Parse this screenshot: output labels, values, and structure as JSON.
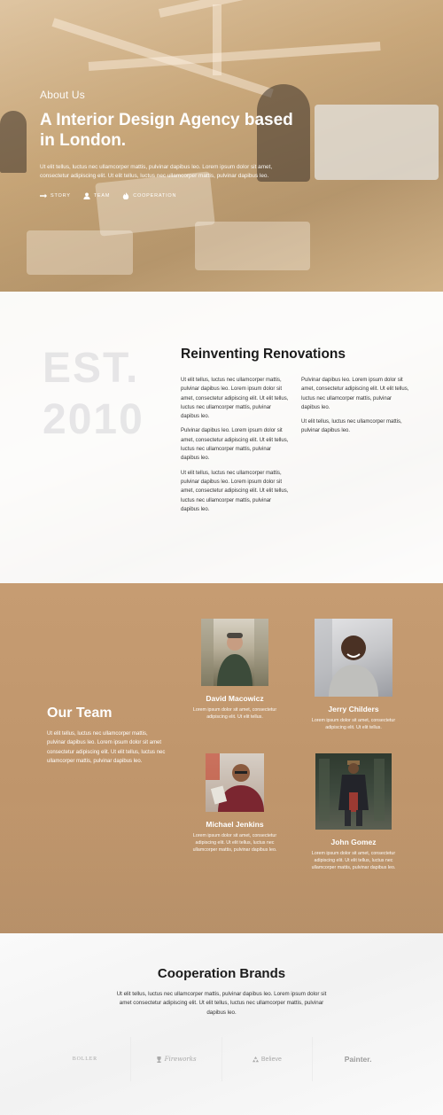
{
  "hero": {
    "eyebrow": "About Us",
    "title": "A Interior Design Agency based in London.",
    "text": "Ut elit tellus, luctus nec ullamcorper mattis, pulvinar dapibus leo. Lorem ipsum dolor sit amet, consectetur adipiscing elit. Ut elit tellus, luctus nec ullamcorper mattis, pulvinar dapibus leo.",
    "links": [
      {
        "label": "STORY",
        "icon": "arrow-right-icon"
      },
      {
        "label": "TEAM",
        "icon": "user-icon"
      },
      {
        "label": "COOPERATION",
        "icon": "fire-icon"
      }
    ]
  },
  "about": {
    "watermark_line1": "EST.",
    "watermark_line2": "2010",
    "title": "Reinventing Renovations",
    "col1": [
      "Ut elit tellus, luctus nec ullamcorper mattis, pulvinar dapibus leo. Lorem ipsum dolor sit amet, consectetur adipiscing elit. Ut elit tellus, luctus nec ullamcorper mattis, pulvinar dapibus leo.",
      "Pulvinar dapibus leo. Lorem ipsum dolor sit amet, consectetur adipiscing elit. Ut elit tellus, luctus nec ullamcorper mattis, pulvinar dapibus leo.",
      "Ut elit tellus, luctus nec ullamcorper mattis, pulvinar dapibus leo. Lorem ipsum dolor sit amet, consectetur adipiscing elit. Ut elit tellus, luctus nec ullamcorper mattis, pulvinar dapibus leo."
    ],
    "col2": [
      "Pulvinar dapibus leo. Lorem ipsum dolor sit amet, consectetur adipiscing elit. Ut elit tellus, luctus nec ullamcorper mattis, pulvinar dapibus leo.",
      "Ut elit tellus, luctus nec ullamcorper mattis, pulvinar dapibus leo."
    ]
  },
  "team": {
    "title": "Our Team",
    "text": "Ut elit tellus, luctus nec ullamcorper mattis, pulvinar dapibus leo. Lorem ipsum dolor sit amet consectetur adipiscing elit. Ut elit tellus, luctus nec ullamcorper mattis, pulvinar dapibus leo.",
    "members": [
      {
        "name": "David Macowicz",
        "bio": "Lorem ipsum dolor sit amet, consectetur adipiscing elit. Ut elit tellus."
      },
      {
        "name": "Jerry Childers",
        "bio": "Lorem ipsum dolor sit amet, consectetur adipiscing elit. Ut elit tellus."
      },
      {
        "name": "Michael Jenkins",
        "bio": "Lorem ipsum dolor sit amet, consectetur adipiscing elit. Ut elit tellus, luctus nec ullamcorper mattis, pulvinar dapibus leo."
      },
      {
        "name": "John Gomez",
        "bio": "Lorem ipsum dolor sit amet, consectetur adipiscing elit. Ut elit tellus, luctus nec ullamcorper mattis, pulvinar dapibus leo."
      }
    ]
  },
  "brands": {
    "title": "Cooperation Brands",
    "text": "Ut elit tellus, luctus nec ullamcorper mattis, pulvinar dapibus leo. Lorem ipsum dolor sit amet consectetur adipiscing elit. Ut elit tellus, luctus nec ullamcorper mattis, pulvinar dapibus leo.",
    "logos": [
      {
        "label": "BOLLER"
      },
      {
        "label": "Fireworks",
        "icon": "trophy-icon"
      },
      {
        "label": "Believe",
        "icon": "recycle-icon"
      },
      {
        "label": "Painter."
      }
    ]
  },
  "colors": {
    "accent": "#c49a70",
    "heading": "#1b1b1b",
    "text": "#333333"
  }
}
